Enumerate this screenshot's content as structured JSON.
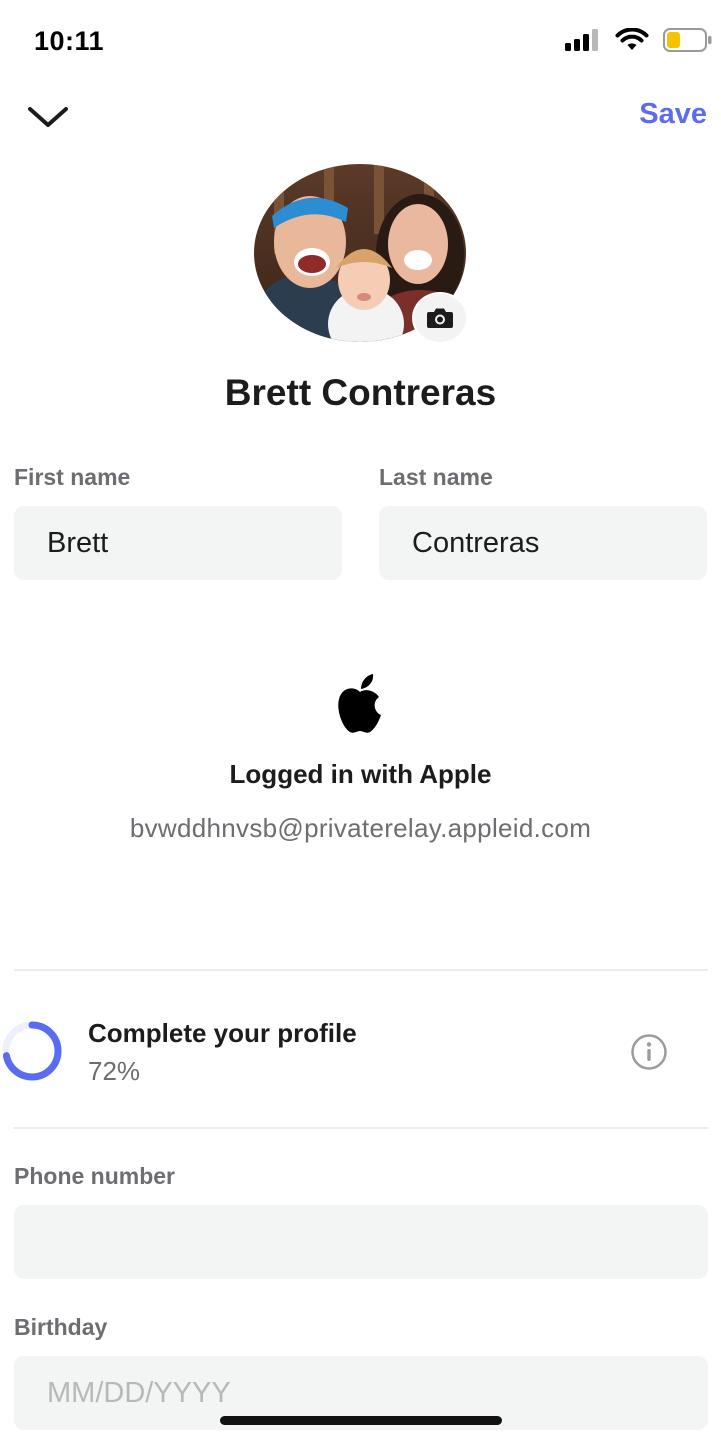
{
  "status_bar": {
    "time": "10:11",
    "battery_color": "#f5c400"
  },
  "nav": {
    "save_label": "Save",
    "back_icon": "chevron-down-icon",
    "accent_color": "#5b6cf2"
  },
  "profile": {
    "name": "Brett Contreras",
    "avatar": "family-photo",
    "camera_icon": "camera-icon"
  },
  "fields": {
    "first_name": {
      "label": "First name",
      "value": "Brett"
    },
    "last_name": {
      "label": "Last name",
      "value": "Contreras"
    },
    "phone": {
      "label": "Phone number",
      "value": "",
      "placeholder": ""
    },
    "birthday": {
      "label": "Birthday",
      "value": "",
      "placeholder": "MM/DD/YYYY"
    }
  },
  "login": {
    "icon": "apple-logo-icon",
    "title": "Logged in with Apple",
    "email": "bvwddhnvsb@privaterelay.appleid.com"
  },
  "completion": {
    "title": "Complete your profile",
    "percent_label": "72%",
    "percent": 72,
    "ring_color": "#5b6cf2",
    "info_icon": "info-icon"
  }
}
